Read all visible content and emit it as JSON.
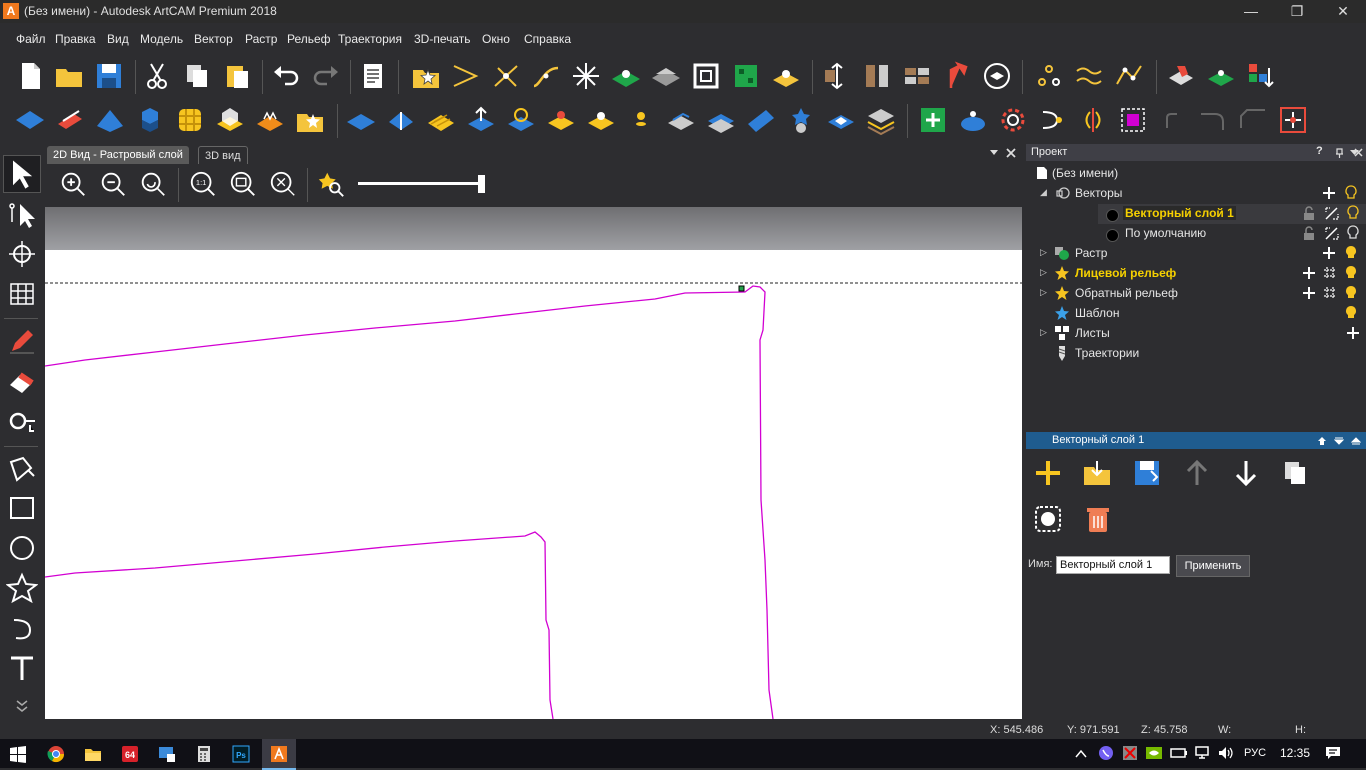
{
  "window": {
    "title": "(Без имени) - Autodesk ArtCAM Premium 2018",
    "app_icon": "A",
    "min": "—",
    "restore": "❐",
    "close": "✕"
  },
  "menu": [
    "Файл",
    "Правка",
    "Вид",
    "Модель",
    "Вектор",
    "Растр",
    "Рельеф",
    "Траектория",
    "3D-печать",
    "Окно",
    "Справка"
  ],
  "tabs": {
    "tab1": "2D Вид - Растровый слой",
    "tab2": "3D вид"
  },
  "view": {
    "zoom_label": "1:1"
  },
  "project": {
    "title": "Проект",
    "help": "?",
    "root": "(Без имени)",
    "vectors": "Векторы",
    "layer1": "Векторный слой 1",
    "layer_default": "По умолчанию",
    "raster": "Растр",
    "front_relief": "Лицевой рельеф",
    "back_relief": "Обратный рельеф",
    "template": "Шаблон",
    "sheets": "Листы",
    "toolpaths": "Траектории"
  },
  "layer_panel": {
    "title": "Векторный слой 1",
    "name_label": "Имя:",
    "name_value": "Векторный слой 1",
    "apply": "Применить"
  },
  "status": {
    "x": "X: 545.486",
    "y": "Y: 971.591",
    "z": "Z: 45.758",
    "w": "W:",
    "h": "H:"
  },
  "taskbar": {
    "lang": "РУС",
    "time": "12:35"
  },
  "colors": {
    "accent": "#1f5c8f",
    "highlight": "#f5d000",
    "vector": "#d200d2",
    "icon_blue": "#2f7fd8",
    "icon_yellow": "#f7c520"
  }
}
